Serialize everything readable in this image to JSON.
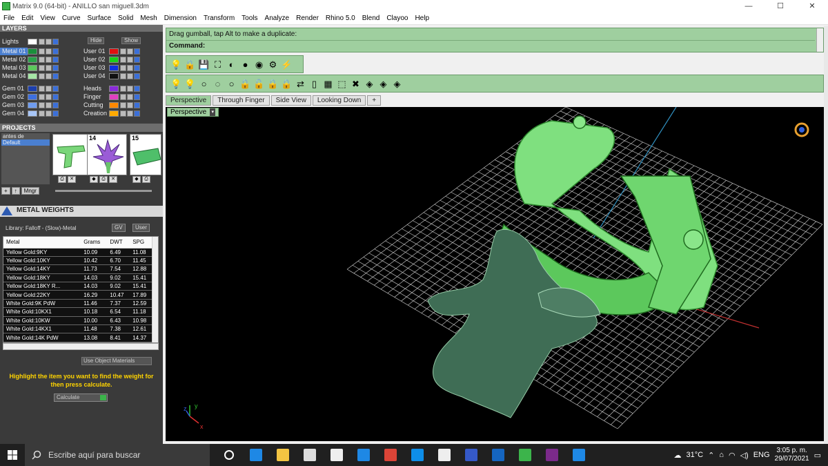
{
  "window": {
    "title": "Matrix 9.0 (64-bit) - ANILLO san miguell.3dm",
    "minimize": "—",
    "maximize": "☐",
    "close": "✕"
  },
  "menu": [
    "File",
    "Edit",
    "View",
    "Curve",
    "Surface",
    "Solid",
    "Mesh",
    "Dimension",
    "Transform",
    "Tools",
    "Analyze",
    "Render",
    "Rhino 5.0",
    "Blend",
    "Clayoo",
    "Help"
  ],
  "layers": {
    "header": "LAYERS",
    "hide_label": "Hide",
    "show_label": "Show",
    "left": [
      {
        "name": "Lights",
        "color": "#ffffff"
      },
      {
        "name": "Metal 01",
        "color": "#1a8f3c",
        "selected": true
      },
      {
        "name": "Metal 02",
        "color": "#2aa14a"
      },
      {
        "name": "Metal 03",
        "color": "#5cc85c"
      },
      {
        "name": "Metal 04",
        "color": "#a6e6a6"
      },
      {
        "name": "Gem 01",
        "color": "#1c3fae"
      },
      {
        "name": "Gem 02",
        "color": "#3d6fe0"
      },
      {
        "name": "Gem 03",
        "color": "#6f9cf0"
      },
      {
        "name": "Gem 04",
        "color": "#a8c6f7"
      }
    ],
    "right": [
      {
        "name": "User 01",
        "color": "#e01010"
      },
      {
        "name": "User 02",
        "color": "#18d018"
      },
      {
        "name": "User 03",
        "color": "#1030e0"
      },
      {
        "name": "User 04",
        "color": "#101010"
      },
      {
        "name": "Heads",
        "color": "#8a2bd8"
      },
      {
        "name": "Finger",
        "color": "#e040c0"
      },
      {
        "name": "Cutting",
        "color": "#ff8800"
      },
      {
        "name": "Creation",
        "color": "#ffaa00"
      }
    ]
  },
  "projects": {
    "header": "PROJECTS",
    "list": [
      "antes de",
      "Default"
    ],
    "thumb_numbers": [
      "14",
      "15"
    ],
    "add_label": "+",
    "up_label": "↑",
    "manager_label": "Mngr"
  },
  "metal_weights": {
    "header": "METAL WEIGHTS",
    "library": "Library: Falloff - (Slow)-Metal",
    "gv_label": "GV",
    "user_label": "User",
    "columns": [
      "Metal",
      "Grams",
      "DWT",
      "SPG"
    ],
    "rows": [
      [
        "Yellow Gold:9KY",
        "10.09",
        "6.49",
        "11.08"
      ],
      [
        "Yellow Gold:10KY",
        "10.42",
        "6.70",
        "11.45"
      ],
      [
        "Yellow Gold:14KY",
        "11.73",
        "7.54",
        "12.88"
      ],
      [
        "Yellow Gold:18KY",
        "14.03",
        "9.02",
        "15.41"
      ],
      [
        "Yellow Gold:18KY R...",
        "14.03",
        "9.02",
        "15.41"
      ],
      [
        "Yellow Gold:22KY",
        "16.29",
        "10.47",
        "17.89"
      ],
      [
        "White Gold:9K PdW",
        "11.46",
        "7.37",
        "12.59"
      ],
      [
        "White Gold:10KX1",
        "10.18",
        "6.54",
        "11.18"
      ],
      [
        "White Gold:10KW",
        "10.00",
        "6.43",
        "10.98"
      ],
      [
        "White Gold:14KX1",
        "11.48",
        "7.38",
        "12.61"
      ],
      [
        "White Gold:14K PdW",
        "13.08",
        "8.41",
        "14.37"
      ]
    ],
    "use_object_materials": "Use Object Materials",
    "instruction": "Highlight the item you want to find the weight for then press calculate.",
    "calculate_label": "Calculate"
  },
  "command": {
    "prompt": "Drag gumball, tap Alt to make a duplicate:",
    "label": "Command:"
  },
  "toolbar1_icons": [
    "bulb-icon",
    "lock-icon",
    "save-icon",
    "zoom-extents-icon",
    "shade-icon",
    "render-sphere-icon",
    "color-wheel-icon",
    "gear-settings-icon",
    "flash-icon"
  ],
  "toolbar2_icons": [
    "bulb-on-icon",
    "bulb-yellow-icon",
    "bulb-off-icon",
    "bulb-select-icon",
    "bulb-outline-icon",
    "lock-icon",
    "unlock-icon",
    "lock-select-icon",
    "lock-all-icon",
    "lock-swap-icon",
    "phone-icon",
    "grid-icon",
    "select-icon",
    "delete-icon",
    "gem-bulb-icon",
    "gem-bulb-2-icon",
    "gem-bulb-3-icon"
  ],
  "tabs": [
    "Perspective",
    "Through Finger",
    "Side View",
    "Looking Down",
    "+"
  ],
  "viewport": {
    "label": "Perspective",
    "axis_y": "y",
    "axis_x": "x",
    "axis_z": "z"
  },
  "taskbar": {
    "search_placeholder": "Escribe aquí para buscar",
    "temperature": "31°C",
    "language": "ENG",
    "time": "3:05 p. m.",
    "date": "29/07/2021"
  }
}
